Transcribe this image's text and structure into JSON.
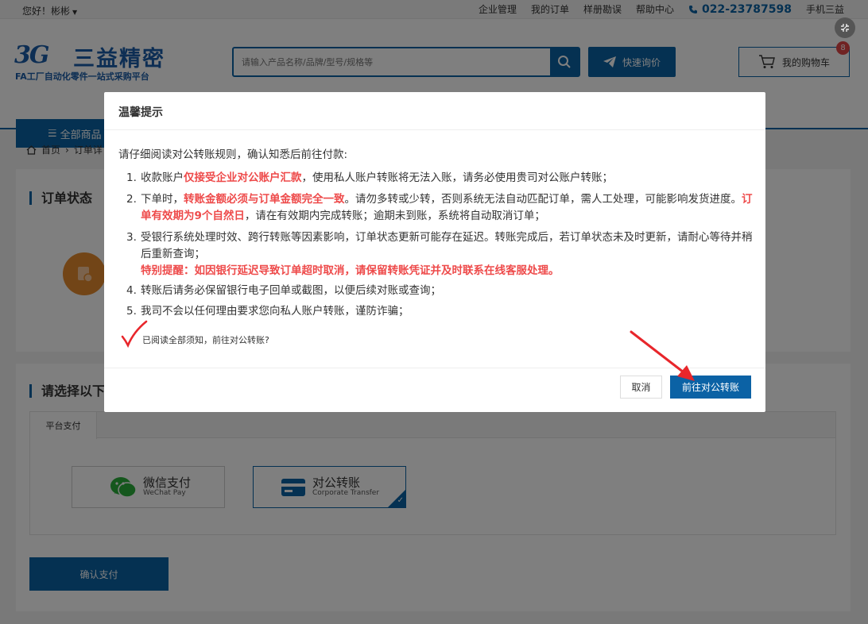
{
  "topbar": {
    "greeting": "您好！彬彬",
    "links": [
      "企业管理",
      "我的订单",
      "样册勘误",
      "帮助中心"
    ],
    "phone": "022-23787598",
    "mobile": "手机三益"
  },
  "header": {
    "logo_mark": "3G",
    "logo_name": "三益精密",
    "slogan": "FA工厂自动化零件一站式采购平台",
    "search_placeholder": "请输入产品名称/品牌/型号/规格等",
    "quick_inquiry": "快速询价",
    "cart_label": "我的购物车",
    "cart_count": "8",
    "all_categories": "全部商品"
  },
  "breadcrumb": {
    "home": "首页",
    "current": "订单详"
  },
  "order_status": {
    "title": "订单状态"
  },
  "payment": {
    "title": "请选择以下",
    "tab": "平台支付",
    "wechat_title": "微信支付",
    "wechat_sub": "WeChat Pay",
    "corp_title": "对公转账",
    "corp_sub": "Corporate Transfer",
    "confirm": "确认支付"
  },
  "modal": {
    "title": "温馨提示",
    "intro": "请仔细阅读对公转账规则，确认知悉后前往付款:",
    "r1": {
      "num": "1.",
      "a": "收款账户",
      "b": "仅接受企业对公账户汇款",
      "c": "，使用私人账户转账将无法入账，请务必使用贵司对公账户转账；"
    },
    "r2": {
      "num": "2.",
      "a": "下单时，",
      "b": "转账金额必须与订单金额完全一致",
      "c": "。请勿多转或少转，否则系统无法自动匹配订单，需人工处理，可能影响发货进度。",
      "d": "订单有效期为9个自然日",
      "e": "，请在有效期内完成转账；逾期未到账，系统将自动取消订单；"
    },
    "r3": {
      "num": "3.",
      "a": "受银行系统处理时效、跨行转账等因素影响，订单状态更新可能存在延迟。转账完成后，若订单状态未及时更新，请耐心等待并稍后重新查询；",
      "b": "特别提醒：如因银行延迟导致订单超时取消，请保留转账凭证并及时联系在线客服处理。"
    },
    "r4": {
      "num": "4.",
      "a": "转账后请务必保留银行电子回单或截图，以便后续对账或查询；"
    },
    "r5": {
      "num": "5.",
      "a": "我司不会以任何理由要求您向私人账户转账，谨防诈骗；"
    },
    "agree": "已阅读全部须知，前往对公转账?",
    "cancel": "取消",
    "go": "前往对公转账"
  },
  "colors": {
    "primary": "#0b62a5",
    "highlight": "#ee4a4a",
    "annotation": "#e8262b"
  }
}
